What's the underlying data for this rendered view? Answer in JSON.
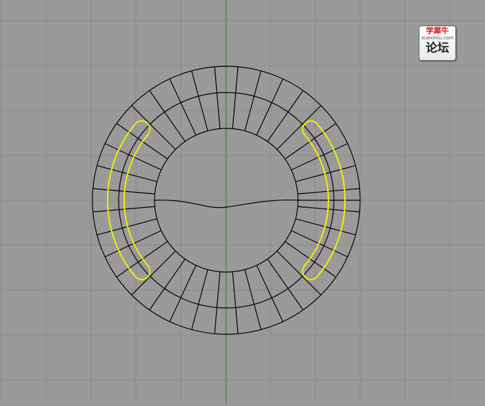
{
  "viewport": {
    "background": "#9a9a9a",
    "grid_color": "#8a8a8a",
    "y_axis_color": "#1b9a2e",
    "wire_color": "#000000",
    "selection_color": "#f0f000"
  },
  "watermark": {
    "brand": "学犀牛",
    "domain": "xuexiniu.com",
    "forum": "论坛"
  }
}
